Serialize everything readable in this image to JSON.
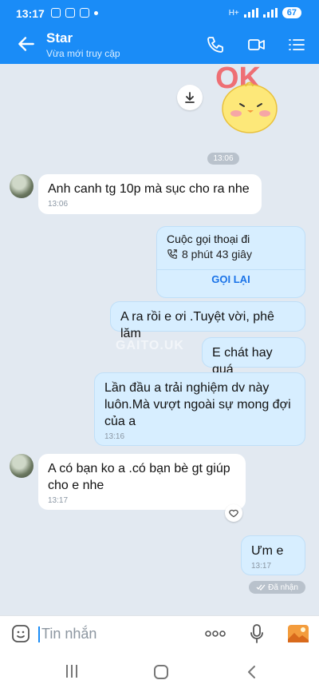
{
  "status_bar": {
    "time": "13:17",
    "network": "H+",
    "battery": "67"
  },
  "header": {
    "title": "Star",
    "subtitle": "Vừa mới truy cập"
  },
  "chat": {
    "time_divider": "13:06",
    "watermark": "GAITO.UK",
    "messages": [
      {
        "text": "Anh canh tg 10p mà sục cho ra nhe",
        "time": "13:06"
      },
      {
        "text": "A ra rồi e ơi .Tuyệt vời, phê lăm"
      },
      {
        "text": "E chát hay quá"
      },
      {
        "text": "Lần đầu a trải nghiệm dv này luôn.Mà vượt ngoài sự mong đợi của a",
        "time": "13:16"
      },
      {
        "text": "A có bạn ko a .có bạn bè gt giúp cho e nhe",
        "time": "13:17"
      },
      {
        "text": "Ưm e",
        "time": "13:17"
      }
    ],
    "call_card": {
      "title": "Cuộc gọi thoại đi",
      "duration": "8 phút 43 giây",
      "action": "GỌI LẠI"
    },
    "received_label": "Đã nhận"
  },
  "input_bar": {
    "placeholder": "Tin nhắn"
  },
  "colors": {
    "primary": "#1a8cf7",
    "chat_bg": "#e2e9f1",
    "outgoing_bubble": "#d7eeff",
    "incoming_bubble": "#ffffff"
  }
}
